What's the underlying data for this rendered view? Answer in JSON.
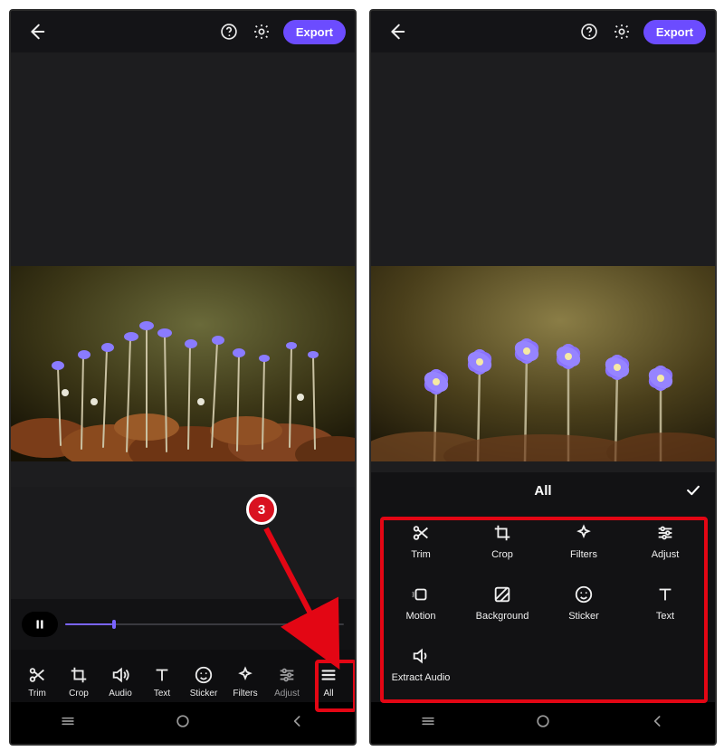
{
  "colors": {
    "accent": "#6c4cff",
    "annotation": "#e30614"
  },
  "annotation": {
    "badge": "3"
  },
  "left": {
    "header": {
      "export": "Export"
    },
    "player": {
      "state": "paused"
    },
    "tools": [
      {
        "key": "trim",
        "label": "Trim"
      },
      {
        "key": "crop",
        "label": "Crop"
      },
      {
        "key": "audio",
        "label": "Audio"
      },
      {
        "key": "text",
        "label": "Text"
      },
      {
        "key": "sticker",
        "label": "Sticker"
      },
      {
        "key": "filters",
        "label": "Filters"
      },
      {
        "key": "adjust",
        "label": "Adjust"
      },
      {
        "key": "all",
        "label": "All"
      }
    ]
  },
  "right": {
    "header": {
      "export": "Export"
    },
    "panel": {
      "title": "All",
      "items": [
        {
          "key": "trim",
          "label": "Trim"
        },
        {
          "key": "crop",
          "label": "Crop"
        },
        {
          "key": "filters",
          "label": "Filters"
        },
        {
          "key": "adjust",
          "label": "Adjust"
        },
        {
          "key": "motion",
          "label": "Motion"
        },
        {
          "key": "background",
          "label": "Background"
        },
        {
          "key": "sticker",
          "label": "Sticker"
        },
        {
          "key": "text",
          "label": "Text"
        },
        {
          "key": "extract-audio",
          "label": "Extract Audio"
        }
      ]
    }
  }
}
